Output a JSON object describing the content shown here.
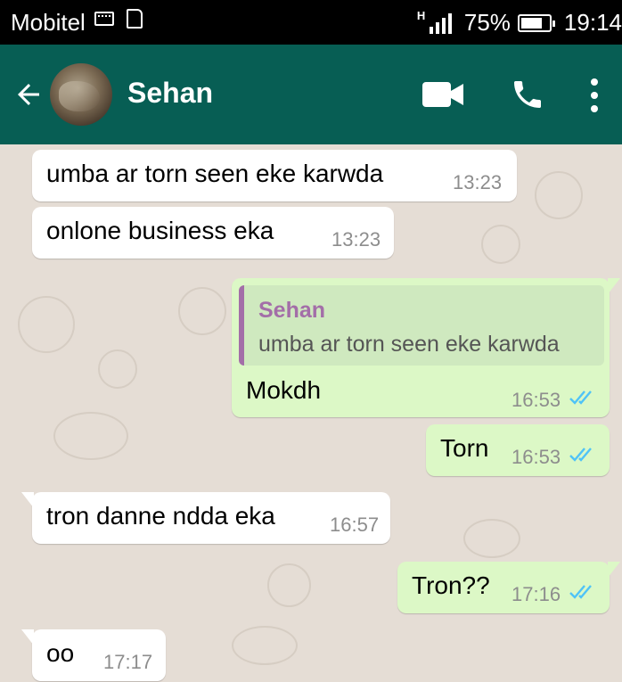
{
  "status_bar": {
    "carrier": "Mobitel",
    "network_type": "H",
    "battery_percent": "75%",
    "battery_level": 0.75,
    "time": "19:14"
  },
  "header": {
    "contact_name": "Sehan",
    "icons": [
      "back-arrow-icon",
      "avatar",
      "video-call-icon",
      "phone-icon",
      "more-vert-icon"
    ]
  },
  "colors": {
    "header": "#075e54",
    "incoming_bubble": "#ffffff",
    "outgoing_bubble": "#dcf8c6",
    "read_ticks": "#4fc3f7",
    "quote_accent": "#a36ea8"
  },
  "messages": [
    {
      "direction": "in",
      "text": "umba ar torn seen eke karwda",
      "time": "13:23"
    },
    {
      "direction": "in",
      "text": "onlone business eka",
      "time": "13:23"
    },
    {
      "direction": "out",
      "quote_author": "Sehan",
      "quote_text": "umba ar torn seen eke karwda",
      "text": "Mokdh",
      "time": "16:53",
      "status": "read"
    },
    {
      "direction": "out",
      "text": "Torn",
      "time": "16:53",
      "status": "read"
    },
    {
      "direction": "in",
      "text": "tron danne ndda eka",
      "time": "16:57"
    },
    {
      "direction": "out",
      "text": "Tron??",
      "time": "17:16",
      "status": "read"
    },
    {
      "direction": "in",
      "text": "oo",
      "time": "17:17"
    }
  ]
}
